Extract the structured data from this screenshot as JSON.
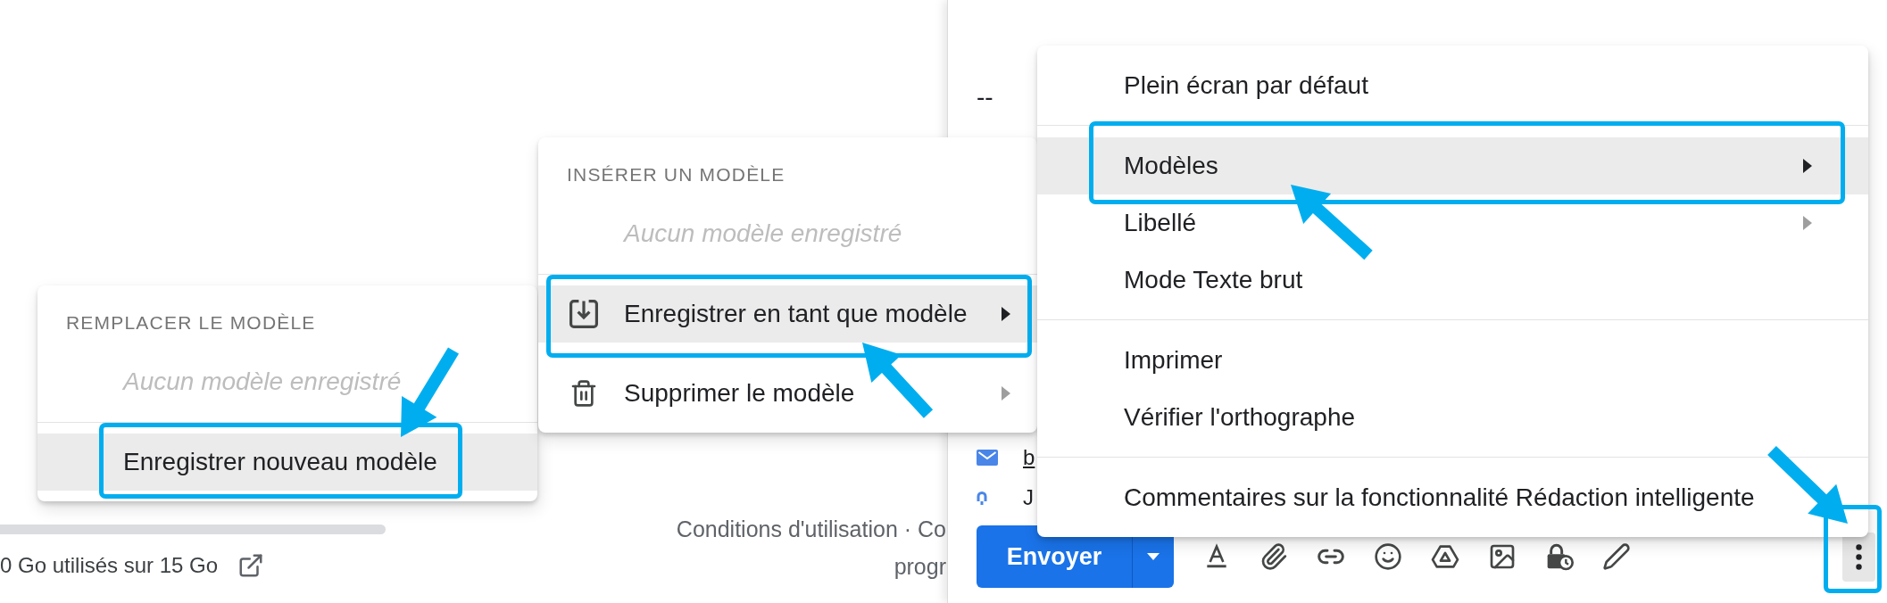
{
  "compose": {
    "body_text": "--",
    "signature": [
      {
        "kind": "mail",
        "text": "b",
        "underlined": true
      },
      {
        "kind": "arch",
        "text": "J",
        "underlined": false
      }
    ],
    "send_button": {
      "label": "Envoyer"
    },
    "more_button": {
      "active": true,
      "annotated": true
    }
  },
  "options_menu": {
    "groups": [
      {
        "items": [
          {
            "label": "Plein écran par défaut",
            "submenu": false,
            "selected": false,
            "annotated": false
          }
        ]
      },
      {
        "items": [
          {
            "label": "Modèles",
            "submenu": true,
            "selected": true,
            "annotated": true
          },
          {
            "label": "Libellé",
            "submenu": true,
            "selected": false,
            "annotated": false
          },
          {
            "label": "Mode Texte brut",
            "submenu": false,
            "selected": false,
            "annotated": false
          }
        ]
      },
      {
        "items": [
          {
            "label": "Imprimer",
            "submenu": false,
            "selected": false,
            "annotated": false
          },
          {
            "label": "Vérifier l'orthographe",
            "submenu": false,
            "selected": false,
            "annotated": false
          }
        ]
      },
      {
        "items": [
          {
            "label": "Commentaires sur la fonctionnalité Rédaction intelligente",
            "submenu": false,
            "selected": false,
            "annotated": false
          }
        ]
      }
    ]
  },
  "templates_menu": {
    "heading": "INSÉRER UN MODÈLE",
    "empty_text": "Aucun modèle enregistré",
    "items": [
      {
        "kind": "save",
        "label": "Enregistrer en tant que modèle",
        "submenu": true,
        "selected": true,
        "annotated": true
      },
      {
        "kind": "delete",
        "label": "Supprimer le modèle",
        "submenu": true,
        "selected": false,
        "annotated": false
      }
    ]
  },
  "replace_menu": {
    "heading": "REMPLACER LE MODÈLE",
    "empty_text": "Aucun modèle enregistré",
    "items": [
      {
        "label": "Enregistrer nouveau modèle",
        "submenu": false,
        "selected": true,
        "annotated": true
      }
    ]
  },
  "page_footer": {
    "storage_usage": "0 Go utilisés sur 15 Go",
    "links": [
      "Conditions d'utilisation · Co",
      "progr"
    ]
  }
}
